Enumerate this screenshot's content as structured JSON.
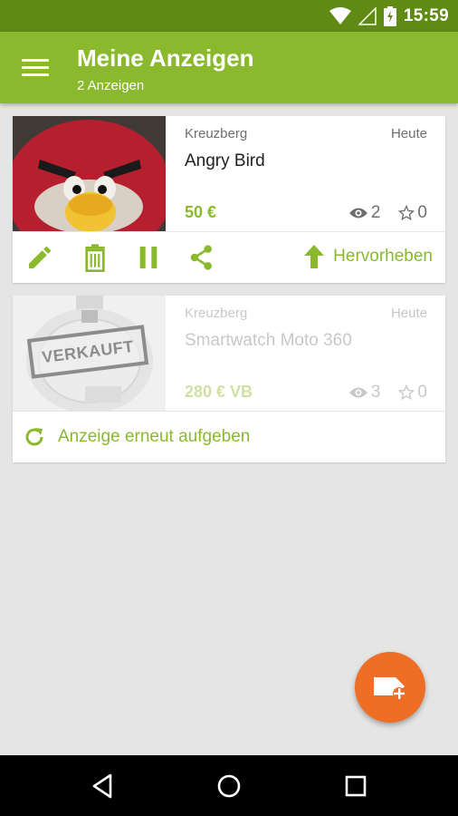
{
  "status_bar": {
    "time": "15:59",
    "icons": [
      "wifi-icon",
      "signal-icon",
      "battery-charging-icon"
    ]
  },
  "app_bar": {
    "menu_icon": "hamburger-menu-icon",
    "title": "Meine Anzeigen",
    "subtitle": "2 Anzeigen"
  },
  "listings": [
    {
      "location": "Kreuzberg",
      "date": "Heute",
      "title": "Angry Bird",
      "price": "50 €",
      "views": "2",
      "favorites": "0",
      "status": "active",
      "actions": {
        "icons": [
          "edit-pencil-icon",
          "delete-trash-icon",
          "pause-icon",
          "share-icon"
        ],
        "promote_label": "Hervorheben",
        "promote_icon": "arrow-up-icon"
      }
    },
    {
      "location": "Kreuzberg",
      "date": "Heute",
      "title": "Smartwatch Moto 360",
      "price": "280 € VB",
      "views": "3",
      "favorites": "0",
      "status": "sold",
      "sold_stamp": "VERKAUFT",
      "relist_label": "Anzeige erneut aufgeben",
      "relist_icon": "refresh-icon"
    }
  ],
  "fab": {
    "icon": "add-listing-tag-icon"
  },
  "nav_bar": {
    "icons": [
      "back-triangle-icon",
      "home-circle-icon",
      "recents-square-icon"
    ]
  },
  "colors": {
    "status_bar": "#5f8a13",
    "app_bar": "#8ab92d",
    "accent": "#8ab92d",
    "fab": "#ee6e26",
    "background": "#e5e5e5"
  }
}
